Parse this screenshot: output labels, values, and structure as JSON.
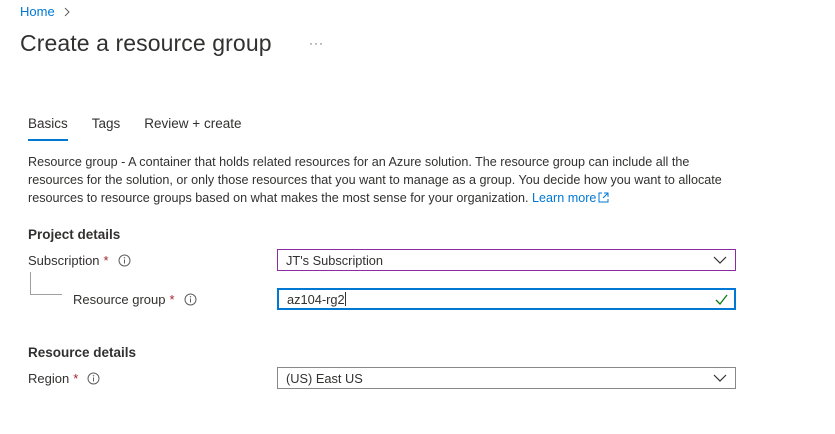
{
  "breadcrumb": {
    "home": "Home"
  },
  "page": {
    "title": "Create a resource group",
    "more": "···"
  },
  "tabs": [
    {
      "label": "Basics"
    },
    {
      "label": "Tags"
    },
    {
      "label": "Review + create"
    }
  ],
  "description": {
    "text": "Resource group - A container that holds related resources for an Azure solution. The resource group can include all the resources for the solution, or only those resources that you want to manage as a group. You decide how you want to allocate resources to resource groups based on what makes the most sense for your organization.",
    "link": "Learn more"
  },
  "project_details": {
    "heading": "Project details",
    "subscription": {
      "label": "Subscription",
      "required": "*",
      "value": "JT's Subscription"
    },
    "resource_group": {
      "label": "Resource group",
      "required": "*",
      "value": "az104-rg2"
    }
  },
  "resource_details": {
    "heading": "Resource details",
    "region": {
      "label": "Region",
      "required": "*",
      "value": "(US) East US"
    }
  },
  "colors": {
    "accent": "#0078d4",
    "required": "#a4262c",
    "valid": "#107c10",
    "focus": "#8a2da5"
  }
}
